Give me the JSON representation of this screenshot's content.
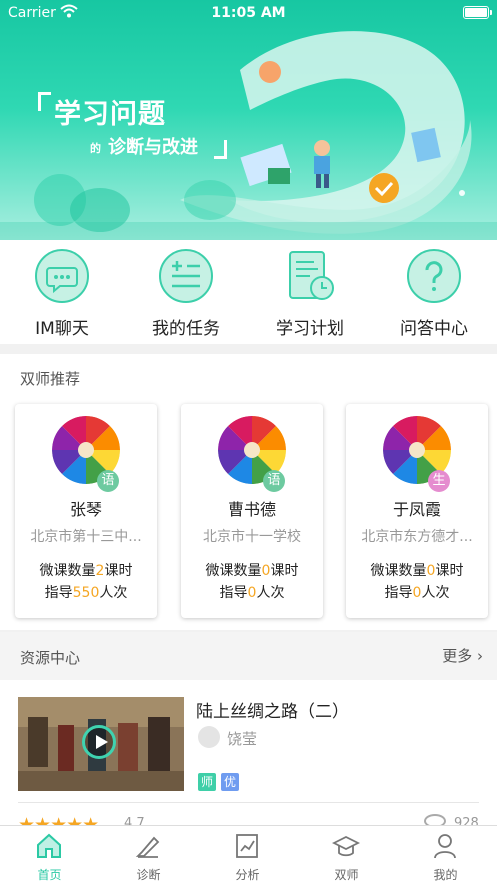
{
  "status_bar": {
    "carrier": "Carrier",
    "time": "11:05 AM"
  },
  "banner": {
    "headline": "学习问题",
    "small_word": "的",
    "subline": "诊断与改进"
  },
  "quick_actions": [
    {
      "label": "IM聊天",
      "icon": "chat-icon"
    },
    {
      "label": "我的任务",
      "icon": "task-list-icon"
    },
    {
      "label": "学习计划",
      "icon": "study-plan-icon"
    },
    {
      "label": "问答中心",
      "icon": "question-icon"
    }
  ],
  "recommend": {
    "title": "双师推荐",
    "teachers": [
      {
        "name": "张琴",
        "subject": "语",
        "subject_color": "#6dcaa0",
        "school": "北京市第十三中...",
        "lessons_prefix": "微课数量",
        "lessons": "2",
        "lessons_suffix": "课时",
        "guide_prefix": "指导",
        "guide": "550",
        "guide_suffix": "人次"
      },
      {
        "name": "曹书德",
        "subject": "语",
        "subject_color": "#6dcaa0",
        "school": "北京市十一学校",
        "lessons_prefix": "微课数量",
        "lessons": "0",
        "lessons_suffix": "课时",
        "guide_prefix": "指导",
        "guide": "0",
        "guide_suffix": "人次"
      },
      {
        "name": "于凤霞",
        "subject": "生",
        "subject_color": "#e58ccf",
        "school": "北京市东方德才...",
        "lessons_prefix": "微课数量",
        "lessons": "0",
        "lessons_suffix": "课时",
        "guide_prefix": "指导",
        "guide": "0",
        "guide_suffix": "人次"
      }
    ]
  },
  "resources": {
    "title": "资源中心",
    "more": "更多",
    "item": {
      "title": "陆上丝绸之路（二）",
      "author": "饶莹",
      "tags": [
        {
          "text": "师",
          "color": "#3fcfa8"
        },
        {
          "text": "优",
          "color": "#6f9cf0"
        }
      ],
      "stars": "★★★★★",
      "rating": "4.7",
      "views": "928"
    }
  },
  "tabbar": [
    {
      "label": "首页",
      "icon": "home-icon",
      "active": true
    },
    {
      "label": "诊断",
      "icon": "diagnose-icon",
      "active": false
    },
    {
      "label": "分析",
      "icon": "analysis-icon",
      "active": false
    },
    {
      "label": "双师",
      "icon": "mortarboard-icon",
      "active": false
    },
    {
      "label": "我的",
      "icon": "profile-icon",
      "active": false
    }
  ],
  "colors": {
    "accent": "#2bc9a4",
    "highlight": "#f5a623"
  }
}
